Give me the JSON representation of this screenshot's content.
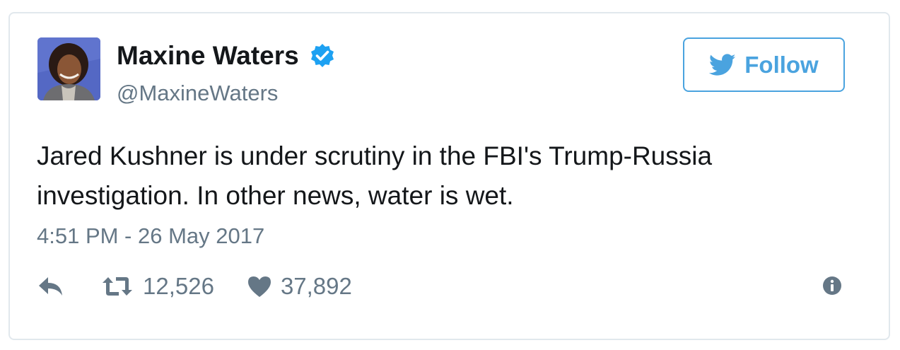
{
  "user": {
    "display_name": "Maxine Waters",
    "handle": "@MaxineWaters",
    "verified": true,
    "avatar_icon": "profile-photo"
  },
  "follow_button": {
    "label": "Follow",
    "icon": "twitter-bird-icon"
  },
  "tweet": {
    "text_line_1": "Jared Kushner is under scrutiny in the FBI's Trump-Russia",
    "text_line_2": "investigation. In other news, water is wet.",
    "timestamp": "4:51 PM - 26 May 2017"
  },
  "actions": {
    "reply_icon": "reply-icon",
    "retweet_icon": "retweet-icon",
    "retweet_count": "12,526",
    "like_icon": "heart-icon",
    "like_count": "37,892",
    "info_icon": "info-icon"
  },
  "colors": {
    "accent": "#4aa3df",
    "verified": "#1da1f2",
    "text": "#14171a",
    "muted": "#657786",
    "border": "#e1e8ed"
  }
}
